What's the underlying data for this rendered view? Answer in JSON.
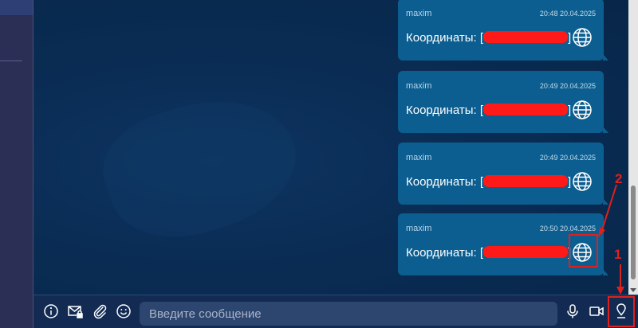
{
  "messages": [
    {
      "author": "maxim",
      "time": "20:48 20.04.2025",
      "text_prefix": "Координаты: [",
      "text_suffix": "]",
      "icon": "globe-icon"
    },
    {
      "author": "maxim",
      "time": "20:49 20.04.2025",
      "text_prefix": "Координаты: [",
      "text_suffix": "]",
      "icon": "globe-icon"
    },
    {
      "author": "maxim",
      "time": "20:49 20.04.2025",
      "text_prefix": "Координаты: [",
      "text_suffix": "]",
      "icon": "globe-icon"
    },
    {
      "author": "maxim",
      "time": "20:50 20.04.2025",
      "text_prefix": "Координаты: [",
      "text_suffix": "]",
      "icon": "globe-icon"
    }
  ],
  "annotations": {
    "label_1": "1",
    "label_2": "2"
  },
  "input": {
    "placeholder": "Введите сообщение",
    "value": ""
  },
  "toolbar": {
    "icons": [
      "info-icon",
      "mail-lock-icon",
      "paperclip-icon",
      "smiley-icon",
      "microphone-icon",
      "video-camera-icon",
      "location-pin-icon"
    ]
  },
  "colors": {
    "annotation_red": "#e0201c",
    "redaction_red": "#ff1a1a",
    "bubble": "#0c5e90"
  }
}
